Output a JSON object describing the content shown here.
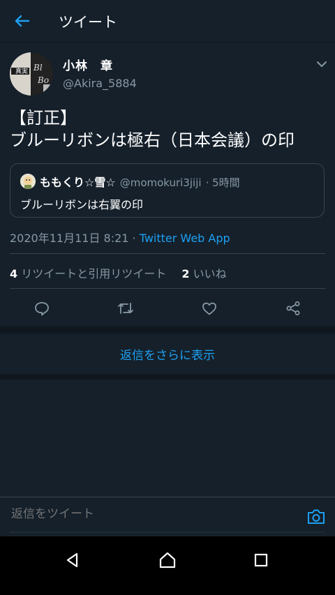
{
  "header": {
    "title": "ツイート"
  },
  "tweet": {
    "author": {
      "name": "小林　章",
      "handle": "@Akira_5884"
    },
    "text_line1": "【訂正】",
    "text_line2": "ブルーリボンは極右（日本会議）の印",
    "quoted": {
      "name": "ももくり☆雪☆",
      "handle": "@momokuri3jiji",
      "time": "· 5時間",
      "text": "ブルーリボンは右翼の印"
    },
    "timestamp": "2020年11月11日 8:21 · ",
    "source": "Twitter Web App",
    "stats": {
      "retweets": "4",
      "retweets_label": " リツイートと引用リツイート",
      "likes": "2",
      "likes_label": " いいね"
    }
  },
  "more_replies": "返信をさらに表示",
  "reply": {
    "placeholder": "返信をツイート"
  },
  "colors": {
    "background": "#15202b",
    "accent": "#1da1f2",
    "secondary_text": "#8899a6",
    "divider": "#38444d"
  },
  "icons": [
    "back-arrow-icon",
    "chevron-down-icon",
    "reply-icon",
    "retweet-icon",
    "like-icon",
    "share-icon",
    "camera-icon",
    "nav-back-icon",
    "nav-home-icon",
    "nav-recents-icon"
  ]
}
